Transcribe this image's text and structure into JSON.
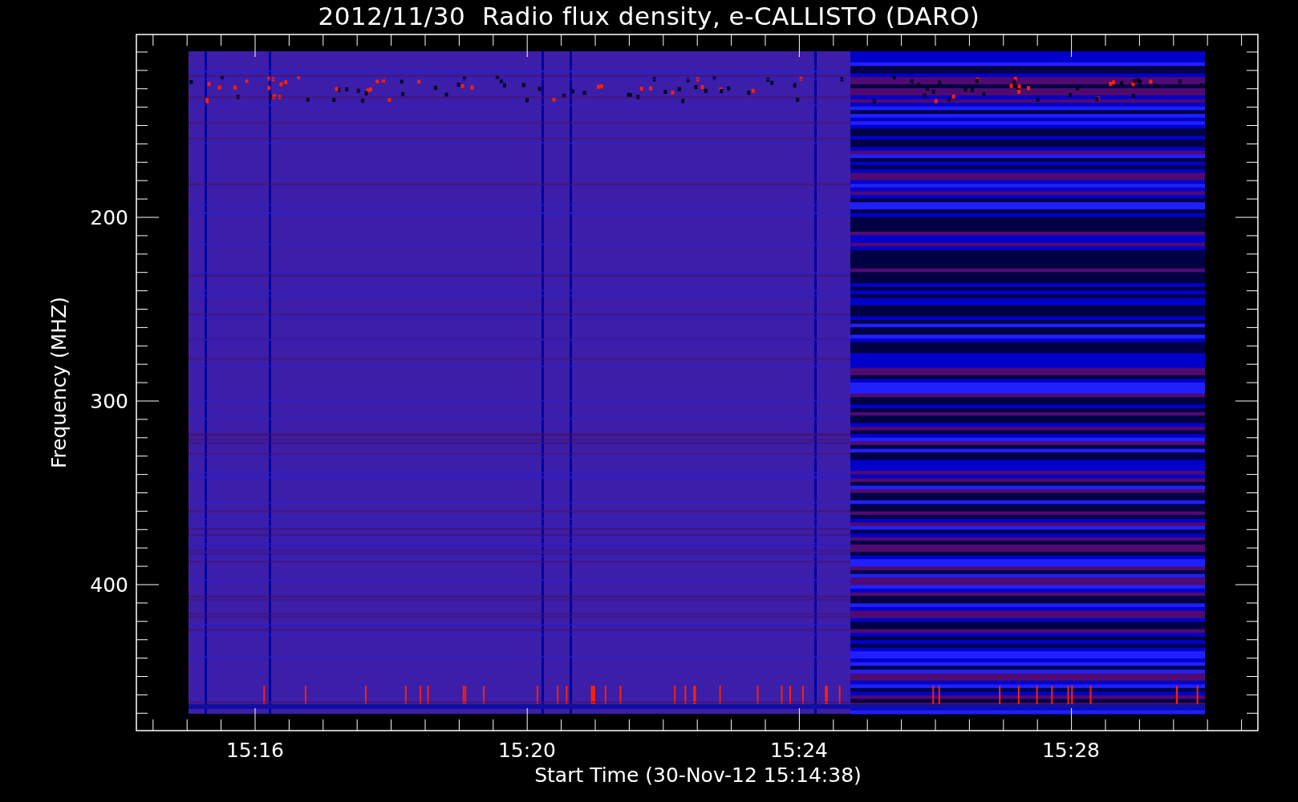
{
  "title": "2012/11/30  Radio flux density, e-CALLISTO (DARO)",
  "plot": {
    "ylabel": "Frequency (MHZ)",
    "xlabel": "Start Time (30-Nov-12 15:14:38)",
    "yticks": [
      "200",
      "300",
      "400"
    ],
    "xticks": [
      "15:16",
      "15:20",
      "15:24",
      "15:28"
    ]
  }
}
